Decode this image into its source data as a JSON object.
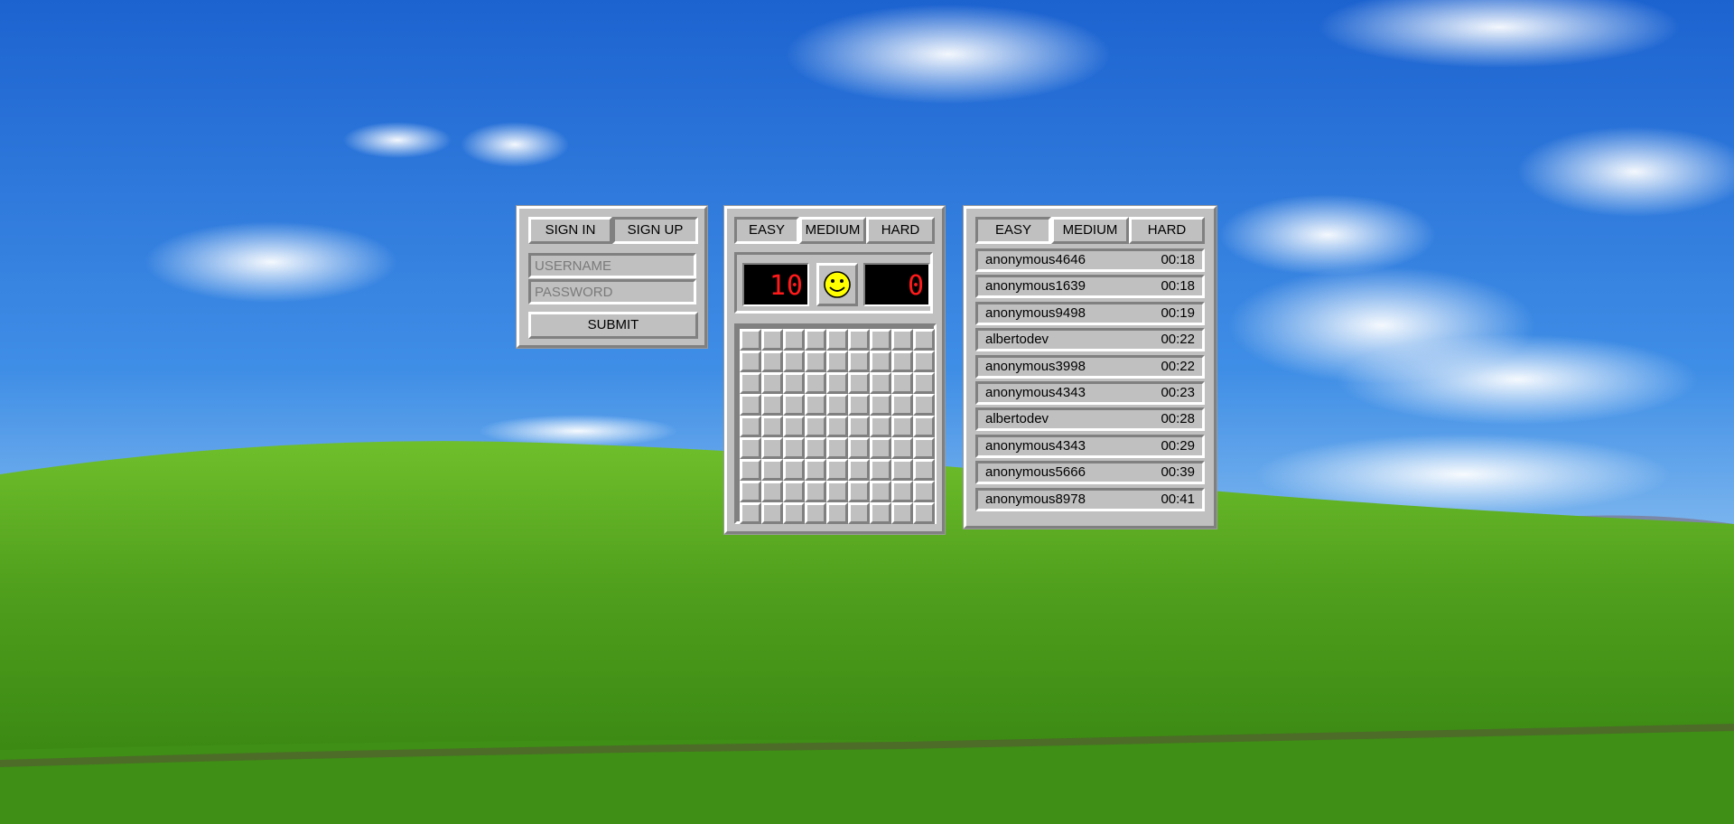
{
  "login": {
    "tabs": [
      "SIGN IN",
      "SIGN UP"
    ],
    "active_tab": 1,
    "username_placeholder": "USERNAME",
    "password_placeholder": "PASSWORD",
    "submit_label": "SUBMIT"
  },
  "game": {
    "tabs": [
      "EASY",
      "MEDIUM",
      "HARD"
    ],
    "active_tab": 0,
    "mine_counter": "10",
    "timer": "0",
    "face": "smiley-face-icon",
    "rows": 9,
    "cols": 9
  },
  "leaderboard": {
    "tabs": [
      "EASY",
      "MEDIUM",
      "HARD"
    ],
    "active_tab": 0,
    "entries": [
      {
        "name": "anonymous4646",
        "time": "00:18"
      },
      {
        "name": "anonymous1639",
        "time": "00:18"
      },
      {
        "name": "anonymous9498",
        "time": "00:19"
      },
      {
        "name": "albertodev",
        "time": "00:22"
      },
      {
        "name": "anonymous3998",
        "time": "00:22"
      },
      {
        "name": "anonymous4343",
        "time": "00:23"
      },
      {
        "name": "albertodev",
        "time": "00:28"
      },
      {
        "name": "anonymous4343",
        "time": "00:29"
      },
      {
        "name": "anonymous5666",
        "time": "00:39"
      },
      {
        "name": "anonymous8978",
        "time": "00:41"
      }
    ]
  },
  "colors": {
    "panel": "#c0c0c0",
    "lcd_text": "#ff1a1a",
    "sky": "#2f7fdc",
    "grass": "#4a9a1e"
  }
}
